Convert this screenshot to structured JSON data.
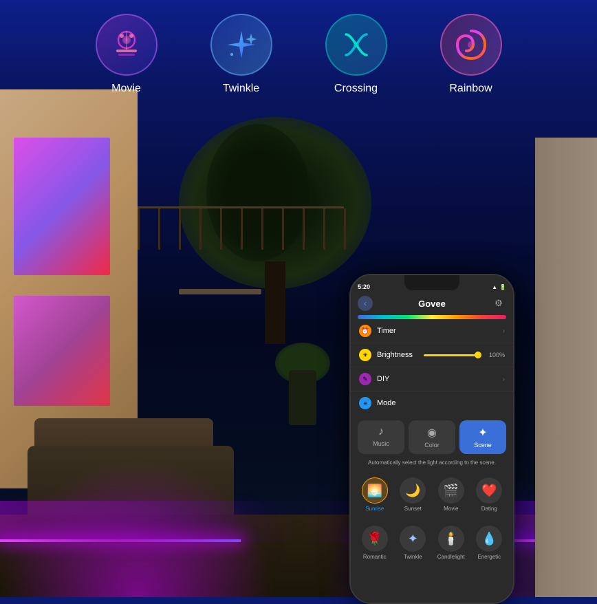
{
  "background": {
    "color": "#0a1a6e"
  },
  "top_icons": {
    "items": [
      {
        "id": "movie",
        "label": "Movie",
        "emoji": "🎬",
        "gradient": "linear-gradient(135deg, #c832c8, #3232c8)"
      },
      {
        "id": "twinkle",
        "label": "Twinkle",
        "emoji": "✦",
        "gradient": "linear-gradient(135deg, #3264c8, #64c8ff)"
      },
      {
        "id": "crossing",
        "label": "Crossing",
        "emoji": "〰",
        "gradient": "linear-gradient(135deg, #00c896, #3296c8)"
      },
      {
        "id": "rainbow",
        "label": "Rainbow",
        "emoji": "🌀",
        "gradient": "linear-gradient(135deg, #c83232, #c864c8)"
      }
    ]
  },
  "phone": {
    "status_bar": {
      "time": "5:20",
      "signal": "●●●",
      "wifi": "▲",
      "battery": "█"
    },
    "header": {
      "title": "Govee",
      "back_label": "‹",
      "settings_label": "⚙"
    },
    "menu_items": [
      {
        "id": "timer",
        "label": "Timer",
        "dot_color": "dot-orange",
        "dot_emoji": "⏰",
        "has_chevron": true
      },
      {
        "id": "brightness",
        "label": "Brightness",
        "value": "100%",
        "dot_color": "dot-yellow",
        "dot_emoji": "☀",
        "has_slider": true
      },
      {
        "id": "diy",
        "label": "DIY",
        "dot_color": "dot-purple",
        "dot_emoji": "✎",
        "has_chevron": true
      },
      {
        "id": "mode",
        "label": "Mode",
        "dot_color": "dot-blue",
        "dot_emoji": "≡",
        "has_chevron": false
      }
    ],
    "mode_tabs": [
      {
        "id": "music",
        "label": "Music",
        "icon": "♪",
        "active": false
      },
      {
        "id": "color",
        "label": "Color",
        "icon": "◉",
        "active": false
      },
      {
        "id": "scene",
        "label": "Scene",
        "icon": "✦",
        "active": true
      }
    ],
    "scene_description": "Automatically select the light according to the scene.",
    "scenes_row1": [
      {
        "id": "sunrise",
        "label": "Sunrise",
        "icon": "🌅",
        "active": true
      },
      {
        "id": "sunset",
        "label": "Sunset",
        "icon": "🌙",
        "active": false
      },
      {
        "id": "movie",
        "label": "Movie",
        "icon": "🎬",
        "active": false
      },
      {
        "id": "dating",
        "label": "Dating",
        "icon": "❤",
        "active": false
      }
    ],
    "scenes_row2": [
      {
        "id": "romantic",
        "label": "Romantic",
        "icon": "🌹",
        "active": false
      },
      {
        "id": "twinkle",
        "label": "Twinkle",
        "icon": "✦",
        "active": false
      },
      {
        "id": "candlelight",
        "label": "Candlelight",
        "icon": "🕯",
        "active": false
      },
      {
        "id": "energetic",
        "label": "Energetic",
        "icon": "💧",
        "active": false
      }
    ]
  }
}
